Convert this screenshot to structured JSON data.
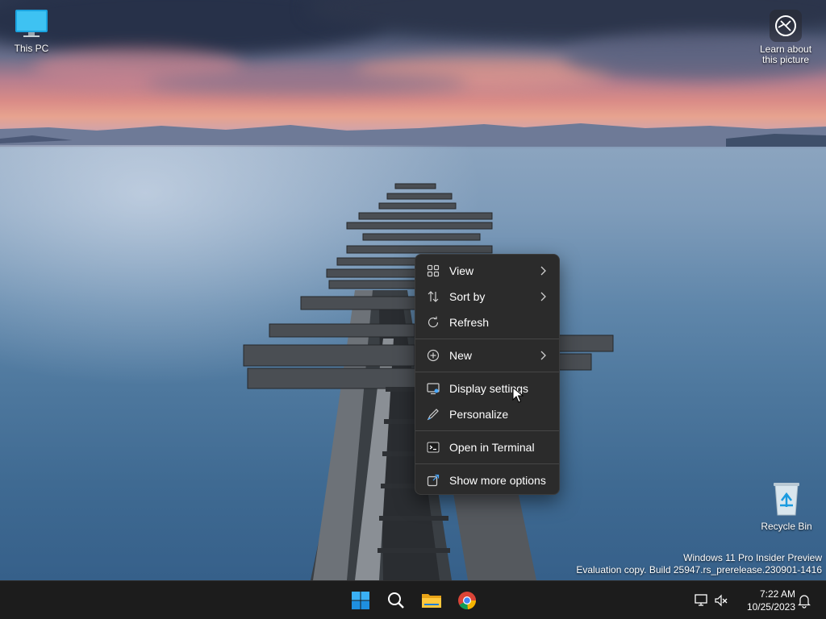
{
  "desktop": {
    "icons": [
      {
        "label": "This PC",
        "icon": "computer-icon"
      },
      {
        "label": "Learn about this picture",
        "icon": "camera-aperture-icon"
      },
      {
        "label": "Recycle Bin",
        "icon": "recycle-bin-icon"
      }
    ],
    "watermark": {
      "line1": "Windows 11 Pro Insider Preview",
      "line2": "Evaluation copy. Build 25947.rs_prerelease.230901-1416"
    }
  },
  "context_menu": {
    "items": [
      {
        "label": "View",
        "icon": "grid-icon",
        "submenu": true
      },
      {
        "label": "Sort by",
        "icon": "sort-arrows-icon",
        "submenu": true
      },
      {
        "label": "Refresh",
        "icon": "refresh-icon",
        "submenu": false
      },
      {
        "label": "New",
        "icon": "plus-circle-icon",
        "submenu": true
      },
      {
        "label": "Display settings",
        "icon": "display-settings-icon",
        "submenu": false
      },
      {
        "label": "Personalize",
        "icon": "pen-icon",
        "submenu": false
      },
      {
        "label": "Open in Terminal",
        "icon": "terminal-icon",
        "submenu": false
      },
      {
        "label": "Show more options",
        "icon": "external-options-icon",
        "submenu": false
      }
    ]
  },
  "taskbar": {
    "apps": [
      {
        "name": "Start",
        "icon": "windows-logo-icon"
      },
      {
        "name": "Search",
        "icon": "search-icon"
      },
      {
        "name": "File Explorer",
        "icon": "folder-icon"
      },
      {
        "name": "Google Chrome",
        "icon": "chrome-icon"
      }
    ],
    "tray": {
      "icons": [
        "network-icon",
        "volume-muted-icon",
        "notification-bell-icon"
      ],
      "time": "7:22 AM",
      "date": "10/25/2023"
    }
  },
  "colors": {
    "menu_bg": "#2b2b2b",
    "taskbar_bg": "#1c1c1c",
    "accent": "#0078d4"
  }
}
